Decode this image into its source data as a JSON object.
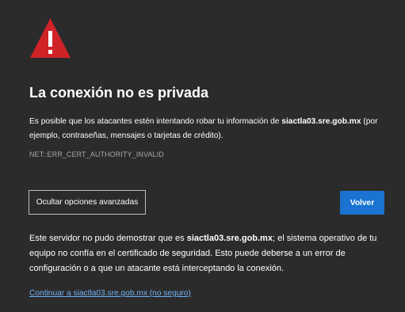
{
  "icons": {
    "warning": "warning-triangle-icon"
  },
  "colors": {
    "background": "#2b2b2b",
    "warning_red": "#d02328",
    "primary_button": "#1a73d0",
    "link": "#6fb3f7",
    "error_code": "#a9a9a9"
  },
  "interstitial": {
    "title": "La conexión no es privada",
    "description": {
      "before_host": "Es posible que los atacantes estén intentando robar tu información de ",
      "host": "siactla03.sre.gob.mx",
      "after_host": " (por ejemplo, contraseñas, mensajes o tarjetas de crédito)."
    },
    "error_code": "NET::ERR_CERT_AUTHORITY_INVALID",
    "buttons": {
      "advanced_label": "Ocultar opciones avanzadas",
      "back_label": "Volver"
    },
    "details": {
      "before_host": "Este servidor no pudo demostrar que es ",
      "host": "siactla03.sre.gob.mx",
      "after_host": "; el sistema operativo de tu equipo no confía en el certificado de seguridad. Esto puede deberse a un error de configuración o a que un atacante está interceptando la conexión."
    },
    "proceed_link": "Continuar a siactla03.sre.gob.mx (no seguro)"
  }
}
